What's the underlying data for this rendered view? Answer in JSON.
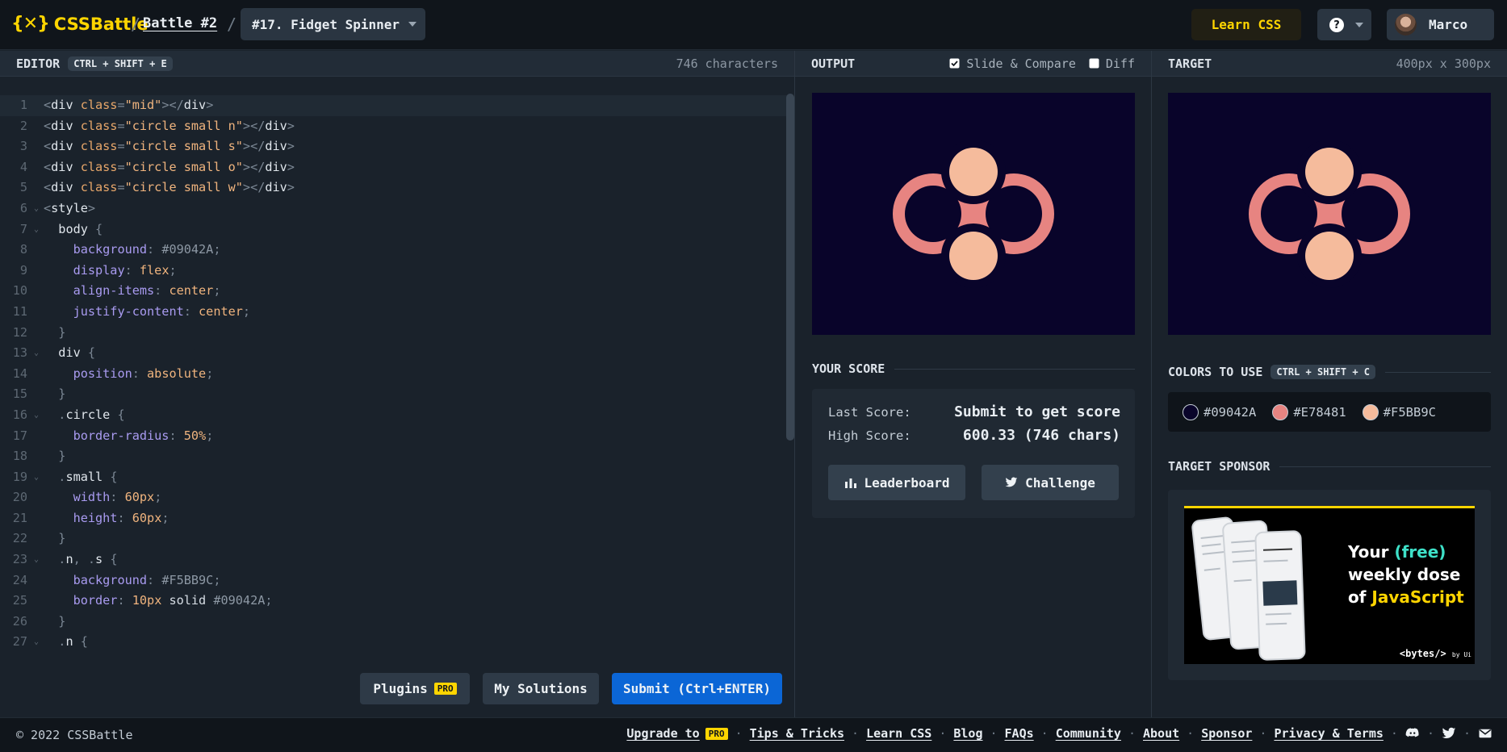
{
  "header": {
    "logo_mark": "{✕}",
    "logo_text": "CSSBattle",
    "separator": "/",
    "battle_link": "Battle #2",
    "challenge": "#17. Fidget Spinner",
    "learn_css": "Learn CSS",
    "help": "?",
    "user_name": "Marco"
  },
  "editor": {
    "title": "EDITOR",
    "shortcut": "CTRL + SHIFT + E",
    "char_count": "746 characters",
    "lines": [
      {
        "n": "1",
        "fold": "",
        "tokens": [
          [
            "punct",
            "<"
          ],
          [
            "tag",
            "div "
          ],
          [
            "attr",
            "class"
          ],
          [
            "punct",
            "="
          ],
          [
            "str",
            "\"mid\""
          ],
          [
            "punct",
            "></"
          ],
          [
            "tag",
            "div"
          ],
          [
            "punct",
            ">"
          ]
        ]
      },
      {
        "n": "2",
        "fold": "",
        "tokens": [
          [
            "punct",
            "<"
          ],
          [
            "tag",
            "div "
          ],
          [
            "attr",
            "class"
          ],
          [
            "punct",
            "="
          ],
          [
            "str",
            "\"circle small n\""
          ],
          [
            "punct",
            "></"
          ],
          [
            "tag",
            "div"
          ],
          [
            "punct",
            ">"
          ]
        ]
      },
      {
        "n": "3",
        "fold": "",
        "tokens": [
          [
            "punct",
            "<"
          ],
          [
            "tag",
            "div "
          ],
          [
            "attr",
            "class"
          ],
          [
            "punct",
            "="
          ],
          [
            "str",
            "\"circle small s\""
          ],
          [
            "punct",
            "></"
          ],
          [
            "tag",
            "div"
          ],
          [
            "punct",
            ">"
          ]
        ]
      },
      {
        "n": "4",
        "fold": "",
        "tokens": [
          [
            "punct",
            "<"
          ],
          [
            "tag",
            "div "
          ],
          [
            "attr",
            "class"
          ],
          [
            "punct",
            "="
          ],
          [
            "str",
            "\"circle small o\""
          ],
          [
            "punct",
            "></"
          ],
          [
            "tag",
            "div"
          ],
          [
            "punct",
            ">"
          ]
        ]
      },
      {
        "n": "5",
        "fold": "",
        "tokens": [
          [
            "punct",
            "<"
          ],
          [
            "tag",
            "div "
          ],
          [
            "attr",
            "class"
          ],
          [
            "punct",
            "="
          ],
          [
            "str",
            "\"circle small w\""
          ],
          [
            "punct",
            "></"
          ],
          [
            "tag",
            "div"
          ],
          [
            "punct",
            ">"
          ]
        ]
      },
      {
        "n": "6",
        "fold": "⌄",
        "tokens": [
          [
            "punct",
            "<"
          ],
          [
            "tag",
            "style"
          ],
          [
            "punct",
            ">"
          ]
        ]
      },
      {
        "n": "7",
        "fold": "⌄",
        "tokens": [
          [
            "txt",
            "  "
          ],
          [
            "sel",
            "body "
          ],
          [
            "punct",
            "{"
          ]
        ]
      },
      {
        "n": "8",
        "fold": "",
        "tokens": [
          [
            "txt",
            "    "
          ],
          [
            "prop",
            "background"
          ],
          [
            "punct",
            ": "
          ],
          [
            "hex",
            "#09042A"
          ],
          [
            "punct",
            ";"
          ]
        ]
      },
      {
        "n": "9",
        "fold": "",
        "tokens": [
          [
            "txt",
            "    "
          ],
          [
            "prop",
            "display"
          ],
          [
            "punct",
            ": "
          ],
          [
            "val",
            "flex"
          ],
          [
            "punct",
            ";"
          ]
        ]
      },
      {
        "n": "10",
        "fold": "",
        "tokens": [
          [
            "txt",
            "    "
          ],
          [
            "prop",
            "align-items"
          ],
          [
            "punct",
            ": "
          ],
          [
            "val",
            "center"
          ],
          [
            "punct",
            ";"
          ]
        ]
      },
      {
        "n": "11",
        "fold": "",
        "tokens": [
          [
            "txt",
            "    "
          ],
          [
            "prop",
            "justify-content"
          ],
          [
            "punct",
            ": "
          ],
          [
            "val",
            "center"
          ],
          [
            "punct",
            ";"
          ]
        ]
      },
      {
        "n": "12",
        "fold": "",
        "tokens": [
          [
            "txt",
            "  "
          ],
          [
            "punct",
            "}"
          ]
        ]
      },
      {
        "n": "13",
        "fold": "⌄",
        "tokens": [
          [
            "txt",
            "  "
          ],
          [
            "sel",
            "div "
          ],
          [
            "punct",
            "{"
          ]
        ]
      },
      {
        "n": "14",
        "fold": "",
        "tokens": [
          [
            "txt",
            "    "
          ],
          [
            "prop",
            "position"
          ],
          [
            "punct",
            ": "
          ],
          [
            "val",
            "absolute"
          ],
          [
            "punct",
            ";"
          ]
        ]
      },
      {
        "n": "15",
        "fold": "",
        "tokens": [
          [
            "txt",
            "  "
          ],
          [
            "punct",
            "}"
          ]
        ]
      },
      {
        "n": "16",
        "fold": "⌄",
        "tokens": [
          [
            "txt",
            "  "
          ],
          [
            "punct",
            "."
          ],
          [
            "sel",
            "circle "
          ],
          [
            "punct",
            "{"
          ]
        ]
      },
      {
        "n": "17",
        "fold": "",
        "tokens": [
          [
            "txt",
            "    "
          ],
          [
            "prop",
            "border-radius"
          ],
          [
            "punct",
            ": "
          ],
          [
            "num",
            "50"
          ],
          [
            "val",
            "%"
          ],
          [
            "punct",
            ";"
          ]
        ]
      },
      {
        "n": "18",
        "fold": "",
        "tokens": [
          [
            "txt",
            "  "
          ],
          [
            "punct",
            "}"
          ]
        ]
      },
      {
        "n": "19",
        "fold": "⌄",
        "tokens": [
          [
            "txt",
            "  "
          ],
          [
            "punct",
            "."
          ],
          [
            "sel",
            "small "
          ],
          [
            "punct",
            "{"
          ]
        ]
      },
      {
        "n": "20",
        "fold": "",
        "tokens": [
          [
            "txt",
            "    "
          ],
          [
            "prop",
            "width"
          ],
          [
            "punct",
            ": "
          ],
          [
            "num",
            "60"
          ],
          [
            "val",
            "px"
          ],
          [
            "punct",
            ";"
          ]
        ]
      },
      {
        "n": "21",
        "fold": "",
        "tokens": [
          [
            "txt",
            "    "
          ],
          [
            "prop",
            "height"
          ],
          [
            "punct",
            ": "
          ],
          [
            "num",
            "60"
          ],
          [
            "val",
            "px"
          ],
          [
            "punct",
            ";"
          ]
        ]
      },
      {
        "n": "22",
        "fold": "",
        "tokens": [
          [
            "txt",
            "  "
          ],
          [
            "punct",
            "}"
          ]
        ]
      },
      {
        "n": "23",
        "fold": "⌄",
        "tokens": [
          [
            "txt",
            "  "
          ],
          [
            "punct",
            "."
          ],
          [
            "sel",
            "n"
          ],
          [
            "punct",
            ", ."
          ],
          [
            "sel",
            "s "
          ],
          [
            "punct",
            "{"
          ]
        ]
      },
      {
        "n": "24",
        "fold": "",
        "tokens": [
          [
            "txt",
            "    "
          ],
          [
            "prop",
            "background"
          ],
          [
            "punct",
            ": "
          ],
          [
            "hex",
            "#F5BB9C"
          ],
          [
            "punct",
            ";"
          ]
        ]
      },
      {
        "n": "25",
        "fold": "",
        "tokens": [
          [
            "txt",
            "    "
          ],
          [
            "prop",
            "border"
          ],
          [
            "punct",
            ": "
          ],
          [
            "num",
            "10"
          ],
          [
            "val",
            "px "
          ],
          [
            "txt",
            "solid "
          ],
          [
            "hex",
            "#09042A"
          ],
          [
            "punct",
            ";"
          ]
        ]
      },
      {
        "n": "26",
        "fold": "",
        "tokens": [
          [
            "txt",
            "  "
          ],
          [
            "punct",
            "}"
          ]
        ]
      },
      {
        "n": "27",
        "fold": "⌄",
        "tokens": [
          [
            "txt",
            "  "
          ],
          [
            "punct",
            "."
          ],
          [
            "sel",
            "n "
          ],
          [
            "punct",
            "{"
          ]
        ]
      }
    ],
    "plugins": "Plugins",
    "pro": "PRO",
    "my_solutions": "My Solutions",
    "submit": "Submit (Ctrl+ENTER)"
  },
  "output": {
    "title": "OUTPUT",
    "slide_compare": "Slide & Compare",
    "slide_compare_checked": true,
    "diff": "Diff",
    "diff_checked": false
  },
  "target": {
    "title": "TARGET",
    "size": "400px x 300px"
  },
  "score": {
    "title": "YOUR SCORE",
    "last_label": "Last Score:",
    "last_value": "Submit to get score",
    "high_label": "High Score:",
    "high_value": "600.33 (746 chars)",
    "leaderboard": "Leaderboard",
    "challenge": "Challenge"
  },
  "colors": {
    "title": "COLORS TO USE",
    "shortcut": "CTRL + SHIFT + C",
    "list": [
      {
        "hex": "#09042A",
        "label": "#09042A"
      },
      {
        "hex": "#E78481",
        "label": "#E78481"
      },
      {
        "hex": "#F5BB9C",
        "label": "#F5BB9C"
      }
    ]
  },
  "sponsor": {
    "title": "TARGET SPONSOR",
    "ad_line1": "Your ",
    "ad_free": "(free)",
    "ad_line2": "weekly dose",
    "ad_line3": "of ",
    "ad_js": "JavaScript",
    "ad_brand": "<bytes/>",
    "ad_by": "by Ui"
  },
  "footer": {
    "copyright": "© 2022 CSSBattle",
    "upgrade": "Upgrade to",
    "pro": "PRO",
    "links": [
      "Tips & Tricks",
      "Learn CSS",
      "Blog",
      "FAQs",
      "Community",
      "About",
      "Sponsor",
      "Privacy & Terms"
    ]
  }
}
